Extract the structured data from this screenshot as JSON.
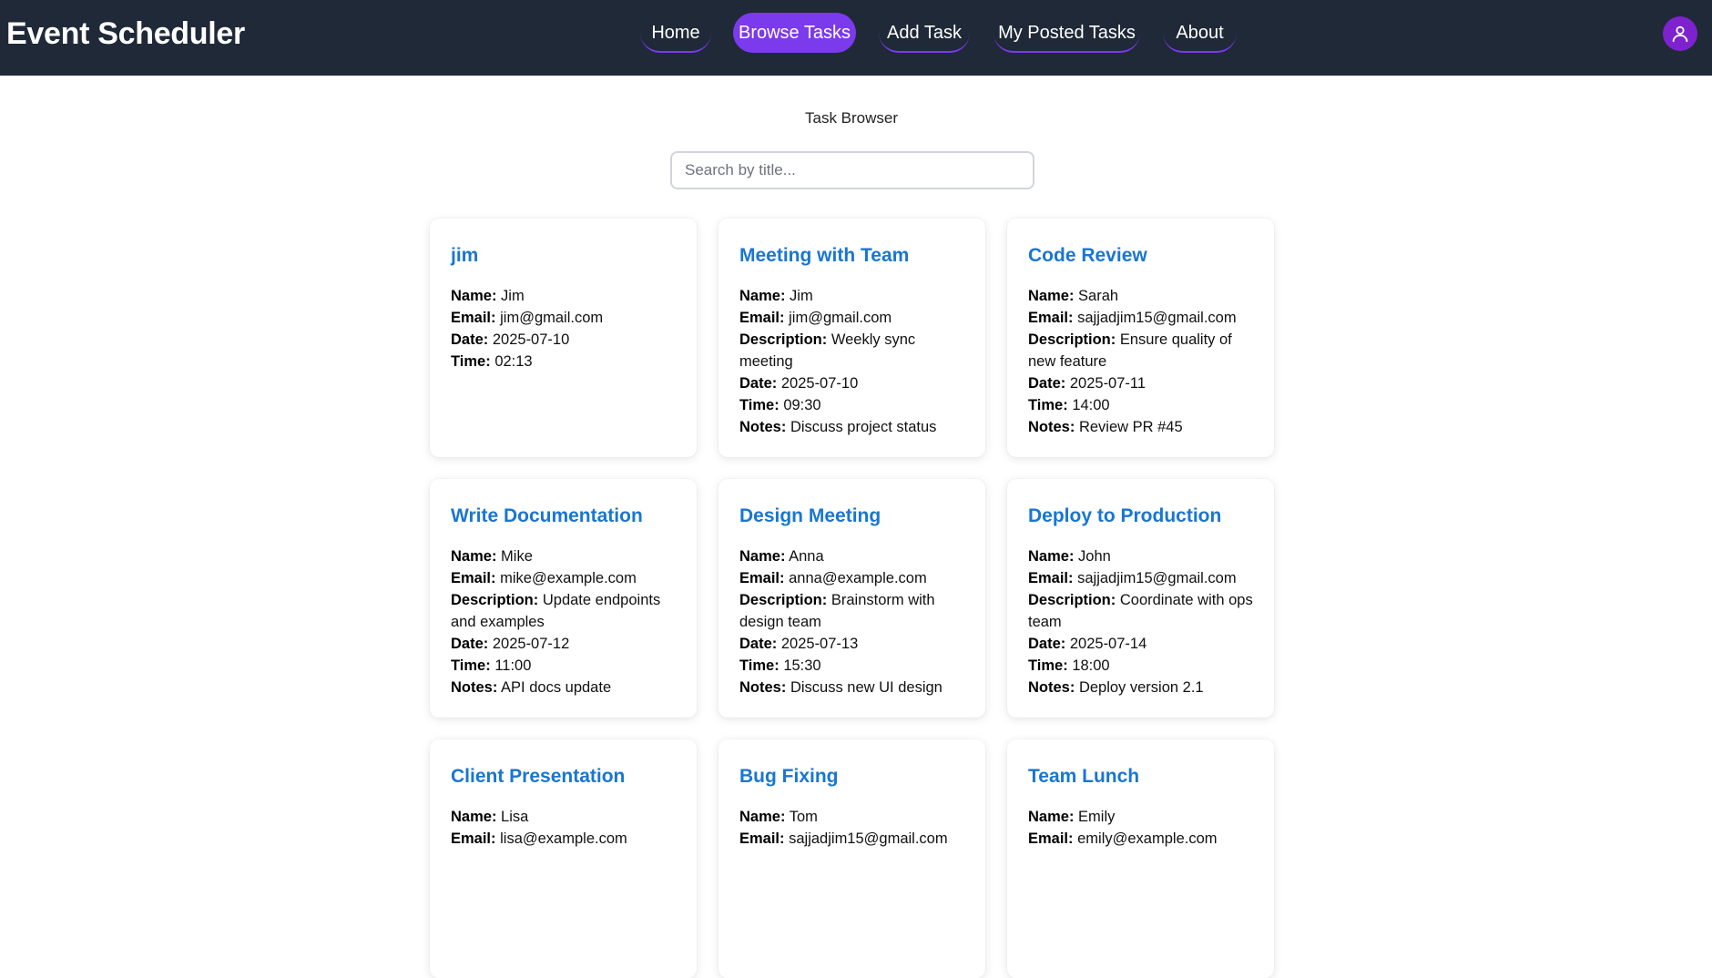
{
  "header": {
    "brand": "Event Scheduler",
    "nav": [
      {
        "label": "Home",
        "active": false
      },
      {
        "label": "Browse Tasks",
        "active": true
      },
      {
        "label": "Add Task",
        "active": false
      },
      {
        "label": "My Posted Tasks",
        "active": false
      },
      {
        "label": "About",
        "active": false
      }
    ],
    "avatar_icon": "user-icon"
  },
  "main": {
    "heading": "Task Browser",
    "search_placeholder": "Search by title...",
    "search_value": ""
  },
  "field_labels": {
    "name": "Name:",
    "email": "Email:",
    "description": "Description:",
    "date": "Date:",
    "time": "Time:",
    "notes": "Notes:"
  },
  "colors": {
    "navbar": "#1f2937",
    "accent": "#7c3aed",
    "title": "#1976d2",
    "avatar": "#7e22ce"
  },
  "tasks": [
    {
      "title": "jim",
      "name": "Jim",
      "email": "jim@gmail.com",
      "date": "2025-07-10",
      "time": "02:13"
    },
    {
      "title": "Meeting with Team",
      "name": "Jim",
      "email": "jim@gmail.com",
      "description": "Weekly sync meeting",
      "date": "2025-07-10",
      "time": "09:30",
      "notes": "Discuss project status"
    },
    {
      "title": "Code Review",
      "name": "Sarah",
      "email": "sajjadjim15@gmail.com",
      "description": "Ensure quality of new feature",
      "date": "2025-07-11",
      "time": "14:00",
      "notes": "Review PR #45"
    },
    {
      "title": "Write Documentation",
      "name": "Mike",
      "email": "mike@example.com",
      "description": "Update endpoints and examples",
      "date": "2025-07-12",
      "time": "11:00",
      "notes": "API docs update"
    },
    {
      "title": "Design Meeting",
      "name": "Anna",
      "email": "anna@example.com",
      "description": "Brainstorm with design team",
      "date": "2025-07-13",
      "time": "15:30",
      "notes": "Discuss new UI design"
    },
    {
      "title": "Deploy to Production",
      "name": "John",
      "email": "sajjadjim15@gmail.com",
      "description": "Coordinate with ops team",
      "date": "2025-07-14",
      "time": "18:00",
      "notes": "Deploy version 2.1"
    },
    {
      "title": "Client Presentation",
      "name": "Lisa",
      "email": "lisa@example.com"
    },
    {
      "title": "Bug Fixing",
      "name": "Tom",
      "email": "sajjadjim15@gmail.com"
    },
    {
      "title": "Team Lunch",
      "name": "Emily",
      "email": "emily@example.com"
    }
  ]
}
